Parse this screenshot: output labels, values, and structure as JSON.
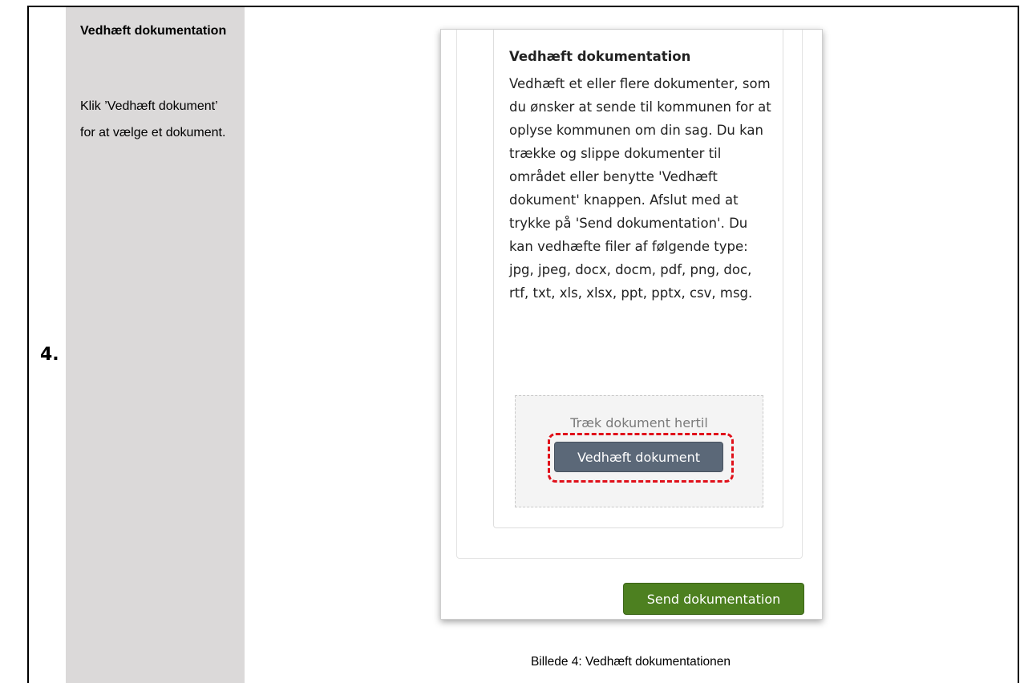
{
  "step": {
    "number": "4."
  },
  "instruction": {
    "title": "Vedhæft dokumentation",
    "text": "Klik ’Vedhæft dokument’ for at vælge et dokument."
  },
  "screenshot": {
    "heading": "Vedhæft dokumentation",
    "description": "Vedhæft et eller flere dokumenter, som du ønsker at sende til kommunen for at oplyse kommunen om din sag. Du kan trække og slippe dokumenter til området eller benytte 'Vedhæft dokument' knappen. Afslut med at trykke på 'Send dokumentation'. Du kan vedhæfte filer af følgende type: jpg, jpeg, docx, docm, pdf, png, doc, rtf, txt, xls, xlsx, ppt, pptx, csv, msg.",
    "dropzone_hint": "Træk dokument hertil",
    "attach_label": "Vedhæft dokument",
    "send_label": "Send dokumentation"
  },
  "caption": "Billede 4: Vedhæft dokumentationen",
  "colors": {
    "instruction_column": "#dbd9d9",
    "attach_button": "#5b6878",
    "send_button": "#4d8020",
    "highlight": "#e0101a"
  }
}
